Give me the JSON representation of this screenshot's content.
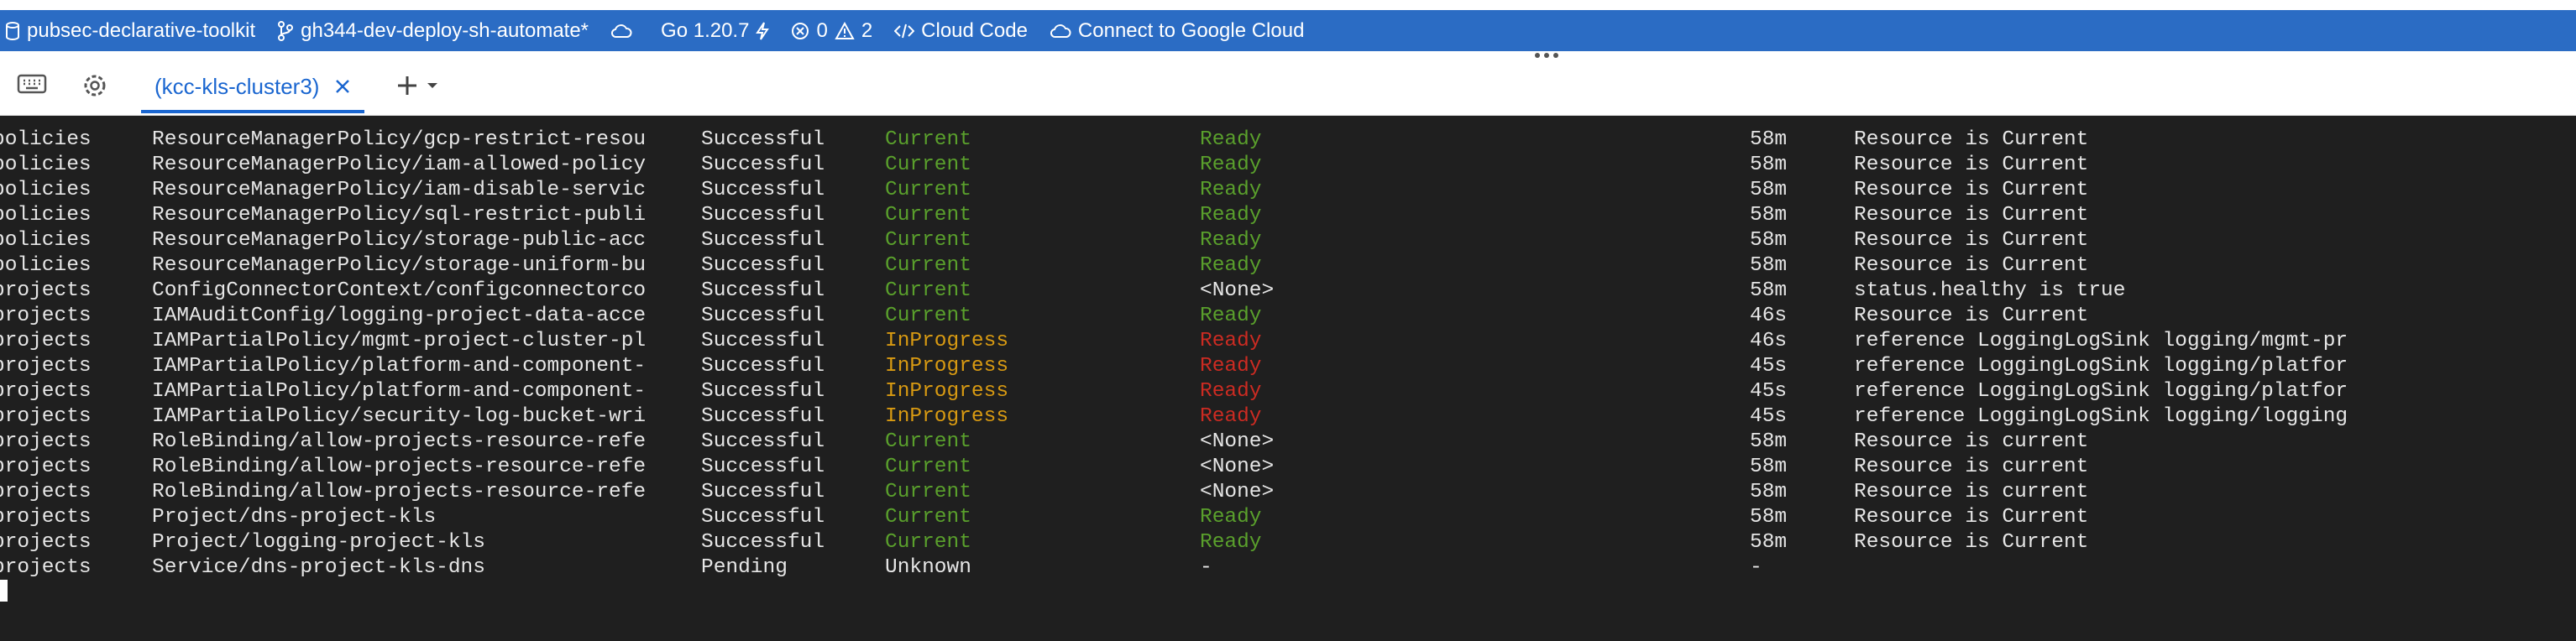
{
  "statusbar": {
    "project": "pubsec-declarative-toolkit",
    "branch": "gh344-dev-deploy-sh-automate*",
    "go_version": "Go 1.20.7",
    "errors_count": "0",
    "warnings_count": "2",
    "cloud_code": "Cloud Code",
    "connect": "Connect to Google Cloud"
  },
  "tabs": [
    {
      "label": "(kcc-kls-cluster3)"
    }
  ],
  "colors": {
    "statusbar_bg": "#2b6cc4",
    "tab_active": "#1a66d0",
    "terminal_bg": "#1f1f1f",
    "green": "#5aa02c",
    "yellow": "#d89a12",
    "red": "#cc2b22"
  },
  "terminal": {
    "rows": [
      {
        "ns": "policies",
        "resource": "ResourceManagerPolicy/gcp-restrict-resou",
        "action": "Successful",
        "status": "Current",
        "conditions": "Ready",
        "age": "58m",
        "message": "Resource is Current"
      },
      {
        "ns": "policies",
        "resource": "ResourceManagerPolicy/iam-allowed-policy",
        "action": "Successful",
        "status": "Current",
        "conditions": "Ready",
        "age": "58m",
        "message": "Resource is Current"
      },
      {
        "ns": "policies",
        "resource": "ResourceManagerPolicy/iam-disable-servic",
        "action": "Successful",
        "status": "Current",
        "conditions": "Ready",
        "age": "58m",
        "message": "Resource is Current"
      },
      {
        "ns": "policies",
        "resource": "ResourceManagerPolicy/sql-restrict-publi",
        "action": "Successful",
        "status": "Current",
        "conditions": "Ready",
        "age": "58m",
        "message": "Resource is Current"
      },
      {
        "ns": "policies",
        "resource": "ResourceManagerPolicy/storage-public-acc",
        "action": "Successful",
        "status": "Current",
        "conditions": "Ready",
        "age": "58m",
        "message": "Resource is Current"
      },
      {
        "ns": "policies",
        "resource": "ResourceManagerPolicy/storage-uniform-bu",
        "action": "Successful",
        "status": "Current",
        "conditions": "Ready",
        "age": "58m",
        "message": "Resource is Current"
      },
      {
        "ns": "projects",
        "resource": "ConfigConnectorContext/configconnectorco",
        "action": "Successful",
        "status": "Current",
        "conditions": "<None>",
        "age": "58m",
        "message": "status.healthy is true"
      },
      {
        "ns": "projects",
        "resource": "IAMAuditConfig/logging-project-data-acce",
        "action": "Successful",
        "status": "Current",
        "conditions": "Ready",
        "age": "46s",
        "message": "Resource is Current"
      },
      {
        "ns": "projects",
        "resource": "IAMPartialPolicy/mgmt-project-cluster-pl",
        "action": "Successful",
        "status": "InProgress",
        "conditions": "Ready",
        "age": "46s",
        "message": "reference LoggingLogSink logging/mgmt-pr"
      },
      {
        "ns": "projects",
        "resource": "IAMPartialPolicy/platform-and-component-",
        "action": "Successful",
        "status": "InProgress",
        "conditions": "Ready",
        "age": "45s",
        "message": "reference LoggingLogSink logging/platfor"
      },
      {
        "ns": "projects",
        "resource": "IAMPartialPolicy/platform-and-component-",
        "action": "Successful",
        "status": "InProgress",
        "conditions": "Ready",
        "age": "45s",
        "message": "reference LoggingLogSink logging/platfor"
      },
      {
        "ns": "projects",
        "resource": "IAMPartialPolicy/security-log-bucket-wri",
        "action": "Successful",
        "status": "InProgress",
        "conditions": "Ready",
        "age": "45s",
        "message": "reference LoggingLogSink logging/logging"
      },
      {
        "ns": "projects",
        "resource": "RoleBinding/allow-projects-resource-refe",
        "action": "Successful",
        "status": "Current",
        "conditions": "<None>",
        "age": "58m",
        "message": "Resource is current"
      },
      {
        "ns": "projects",
        "resource": "RoleBinding/allow-projects-resource-refe",
        "action": "Successful",
        "status": "Current",
        "conditions": "<None>",
        "age": "58m",
        "message": "Resource is current"
      },
      {
        "ns": "projects",
        "resource": "RoleBinding/allow-projects-resource-refe",
        "action": "Successful",
        "status": "Current",
        "conditions": "<None>",
        "age": "58m",
        "message": "Resource is current"
      },
      {
        "ns": "projects",
        "resource": "Project/dns-project-kls",
        "action": "Successful",
        "status": "Current",
        "conditions": "Ready",
        "age": "58m",
        "message": "Resource is Current"
      },
      {
        "ns": "projects",
        "resource": "Project/logging-project-kls",
        "action": "Successful",
        "status": "Current",
        "conditions": "Ready",
        "age": "58m",
        "message": "Resource is Current"
      },
      {
        "ns": "projects",
        "resource": "Service/dns-project-kls-dns",
        "action": "Pending",
        "status": "Unknown",
        "conditions": "-",
        "age": "-",
        "message": ""
      }
    ]
  }
}
